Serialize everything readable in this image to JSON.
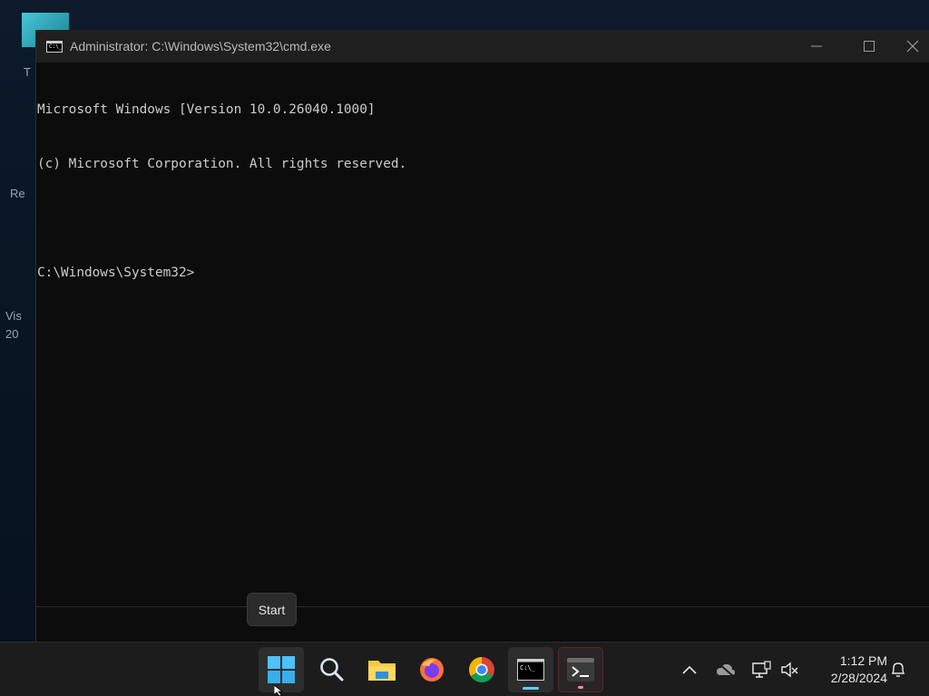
{
  "window": {
    "title": "Administrator: C:\\Windows\\System32\\cmd.exe",
    "icon_text": "C:\\_"
  },
  "console": {
    "lines": [
      "Microsoft Windows [Version 10.0.26040.1000]",
      "(c) Microsoft Corporation. All rights reserved.",
      "",
      "C:\\Windows\\System32>"
    ]
  },
  "desktop_fragments": [
    "T",
    "Re",
    "Vis",
    "20"
  ],
  "tooltip": {
    "text": "Start"
  },
  "taskbar": {
    "apps": [
      {
        "name": "start-button",
        "icon": "windows-logo-icon"
      },
      {
        "name": "search-button",
        "icon": "search-icon"
      },
      {
        "name": "file-explorer-button",
        "icon": "folder-icon"
      },
      {
        "name": "firefox-button",
        "icon": "firefox-icon"
      },
      {
        "name": "chrome-button",
        "icon": "chrome-icon"
      },
      {
        "name": "cmd-button",
        "icon": "cmd-icon"
      },
      {
        "name": "terminal-button",
        "icon": "terminal-icon"
      }
    ],
    "tray": [
      "chevron-up-icon",
      "cloud-offline-icon",
      "network-icon",
      "volume-muted-icon"
    ],
    "time": "1:12 PM",
    "date": "2/28/2024"
  },
  "colors": {
    "console_bg": "#0c0c0c",
    "console_text": "#cccccc",
    "accent_indicator": "#60cdff",
    "terminal_indicator": "#f08d9a"
  }
}
